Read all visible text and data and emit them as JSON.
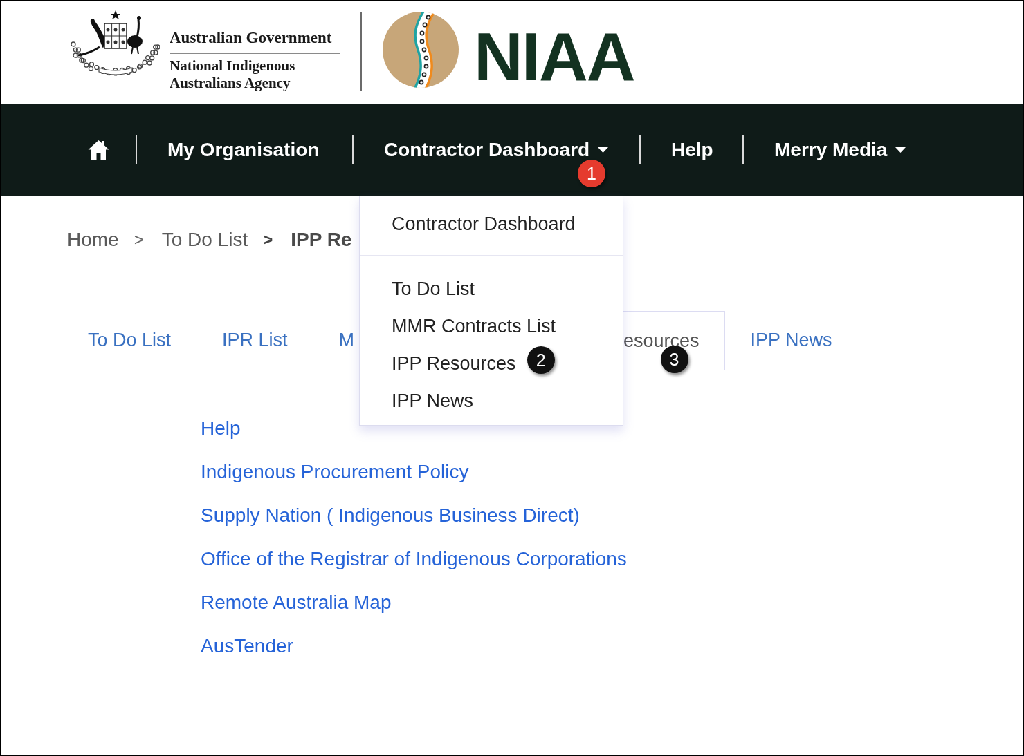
{
  "header": {
    "government": "Australian Government",
    "agency": [
      "National Indigenous",
      "Australians Agency"
    ],
    "wordmark": "NIAA"
  },
  "nav": {
    "items": [
      {
        "kind": "home"
      },
      {
        "kind": "link",
        "label": "My Organisation"
      },
      {
        "kind": "dropdown",
        "label": "Contractor Dashboard",
        "annotation": {
          "label": "1",
          "color": "#e53b2e"
        },
        "menu": {
          "sections": [
            {
              "items": [
                {
                  "label": "Contractor Dashboard"
                }
              ]
            },
            {
              "items": [
                {
                  "label": "To Do List"
                },
                {
                  "label": "MMR Contracts List"
                },
                {
                  "label": "IPP Resources",
                  "annotation": {
                    "label": "2",
                    "color": "#111111"
                  }
                },
                {
                  "label": "IPP News"
                }
              ]
            }
          ]
        }
      },
      {
        "kind": "link",
        "label": "Help"
      },
      {
        "kind": "dropdown",
        "label": "Merry Media"
      }
    ]
  },
  "breadcrumb": [
    {
      "label": "Home",
      "current": false
    },
    {
      "separator": ">",
      "label": "To Do List",
      "current": false
    },
    {
      "separator": ">",
      "label": "IPP Re",
      "current": true
    }
  ],
  "tabs": [
    {
      "label": "To Do List",
      "selected": false
    },
    {
      "label": "IPR List",
      "selected": false
    },
    {
      "label": "M",
      "selected": false
    },
    {
      "label": "esources",
      "selected": true,
      "annotation": {
        "label": "3",
        "color": "#111111"
      }
    },
    {
      "label": "IPP News",
      "selected": false
    }
  ],
  "links": [
    "Help",
    "Indigenous Procurement Policy",
    "Supply Nation ( Indigenous Business Direct)",
    "Office of the Registrar of Indigenous Corporations",
    "Remote Australia Map",
    "AusTender"
  ]
}
